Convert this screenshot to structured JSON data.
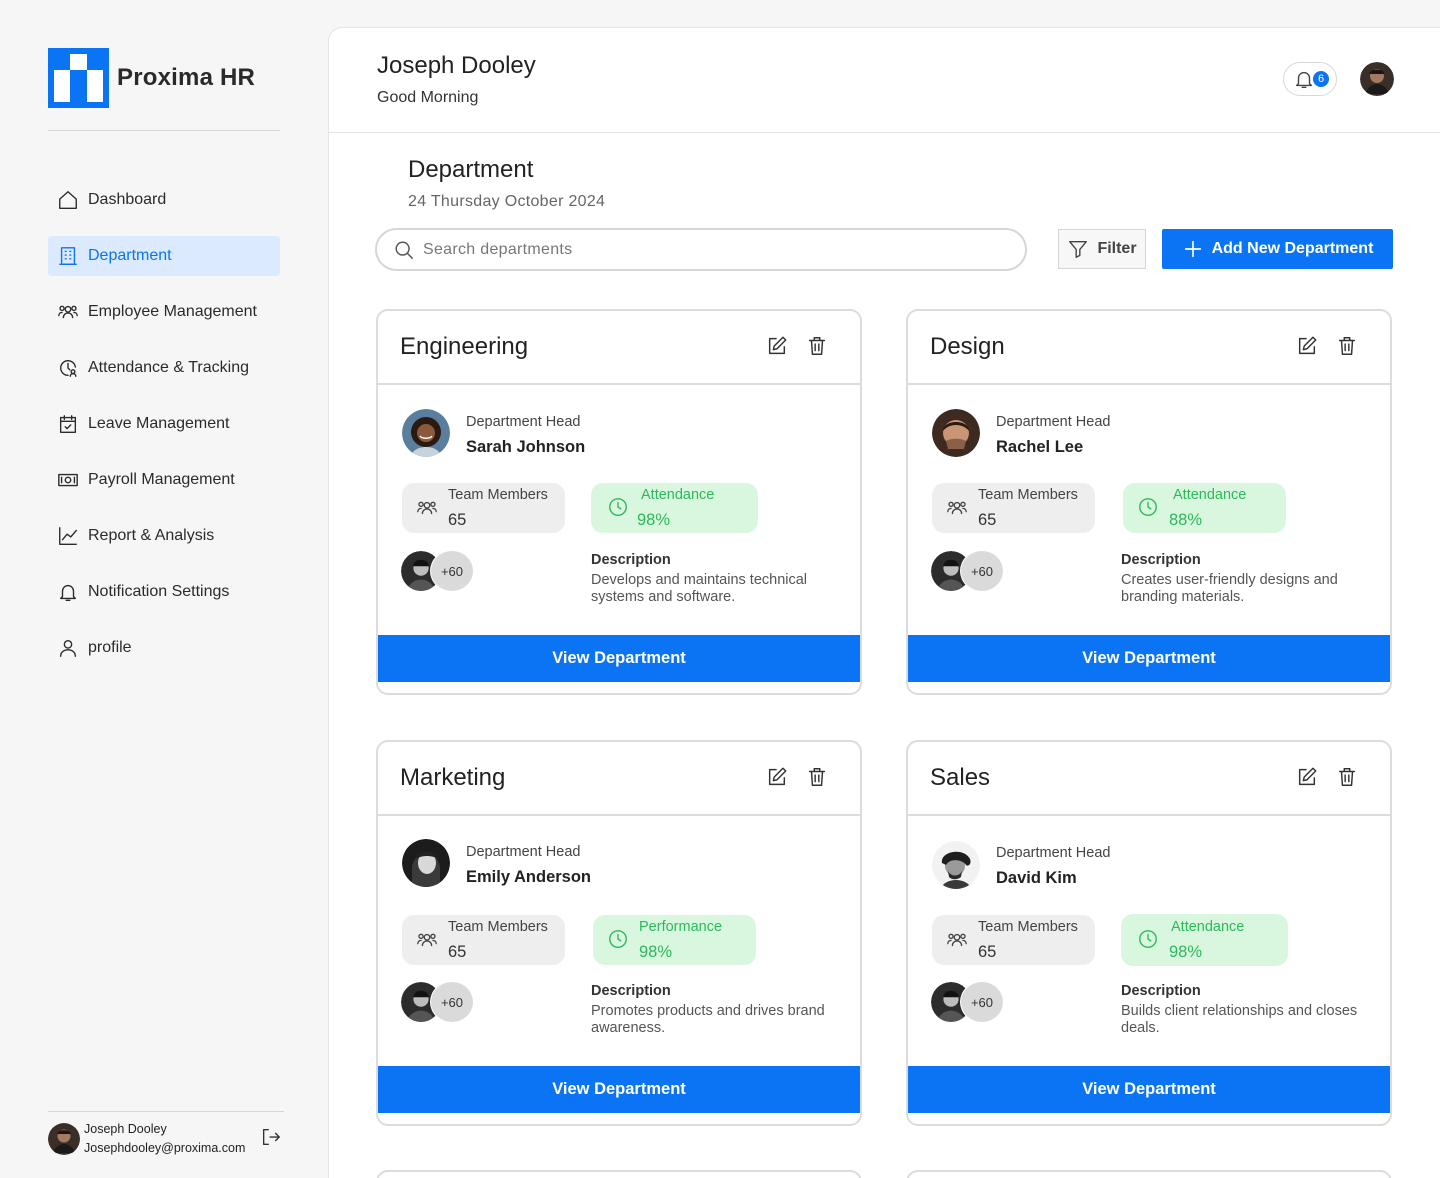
{
  "app": {
    "name": "Proxima HR",
    "brand_color": "#0a74f5"
  },
  "sidebar": {
    "items": [
      {
        "label": "Dashboard",
        "icon": "home-icon",
        "active": false
      },
      {
        "label": "Department",
        "icon": "building-icon",
        "active": true
      },
      {
        "label": "Employee Management",
        "icon": "users-icon",
        "active": false
      },
      {
        "label": "Attendance & Tracking",
        "icon": "clock-user-icon",
        "active": false
      },
      {
        "label": "Leave Management",
        "icon": "calendar-check-icon",
        "active": false
      },
      {
        "label": "Payroll Management",
        "icon": "money-icon",
        "active": false
      },
      {
        "label": "Report & Analysis",
        "icon": "chart-line-icon",
        "active": false
      },
      {
        "label": "Notification Settings",
        "icon": "bell-icon",
        "active": false
      },
      {
        "label": "profile",
        "icon": "user-icon",
        "active": false
      }
    ],
    "user": {
      "name": "Joseph Dooley",
      "email": "Josephdooley@proxima.com"
    }
  },
  "header": {
    "user_name": "Joseph Dooley",
    "greeting": "Good Morning",
    "notification_count": "6"
  },
  "page": {
    "title": "Department",
    "date": "24 Thursday October 2024",
    "search_placeholder": "Search departments",
    "filter_label": "Filter",
    "add_label": "Add New Department"
  },
  "departments": [
    {
      "name": "Engineering",
      "head_label": "Department Head",
      "head_name": "Sarah Johnson",
      "team_label": "Team Members",
      "team_count": "65",
      "metric_label": "Attendance",
      "metric_value": "98%",
      "members_more": "+60",
      "desc_title": "Description",
      "description": "Develops and maintains technical systems and software.",
      "button": "View Department"
    },
    {
      "name": "Design",
      "head_label": "Department Head",
      "head_name": "Rachel Lee",
      "team_label": "Team Members",
      "team_count": "65",
      "metric_label": "Attendance",
      "metric_value": "88%",
      "members_more": "+60",
      "desc_title": "Description",
      "description": "Creates user-friendly designs and branding materials.",
      "button": "View Department"
    },
    {
      "name": "Marketing",
      "head_label": "Department Head",
      "head_name": "Emily Anderson",
      "team_label": "Team Members",
      "team_count": "65",
      "metric_label": "Performance",
      "metric_value": "98%",
      "members_more": "+60",
      "desc_title": "Description",
      "description": "Promotes products and drives brand awareness.",
      "button": "View Department"
    },
    {
      "name": "Sales",
      "head_label": "Department Head",
      "head_name": "David Kim",
      "team_label": "Team Members",
      "team_count": "65",
      "metric_label": "Attendance",
      "metric_value": "98%",
      "members_more": "+60",
      "desc_title": "Description",
      "description": "Builds client relationships and closes deals.",
      "button": "View Department"
    }
  ]
}
